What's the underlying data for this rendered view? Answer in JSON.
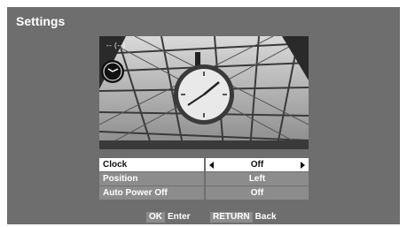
{
  "screen": {
    "title": "Settings"
  },
  "preview": {
    "osd_text": "-- (--)"
  },
  "menu": {
    "rows": [
      {
        "label": "Clock",
        "value": "Off",
        "selected": true
      },
      {
        "label": "Position",
        "value": "Left",
        "selected": false
      },
      {
        "label": "Auto Power Off",
        "value": "Off",
        "selected": false
      }
    ]
  },
  "footer": {
    "enter_key": "OK",
    "enter_label": "Enter",
    "back_key": "RETURN",
    "back_label": "Back"
  },
  "colors": {
    "background": "#6e6e6e",
    "row": "#8c8c8c",
    "selected_row": "#ffffff"
  }
}
